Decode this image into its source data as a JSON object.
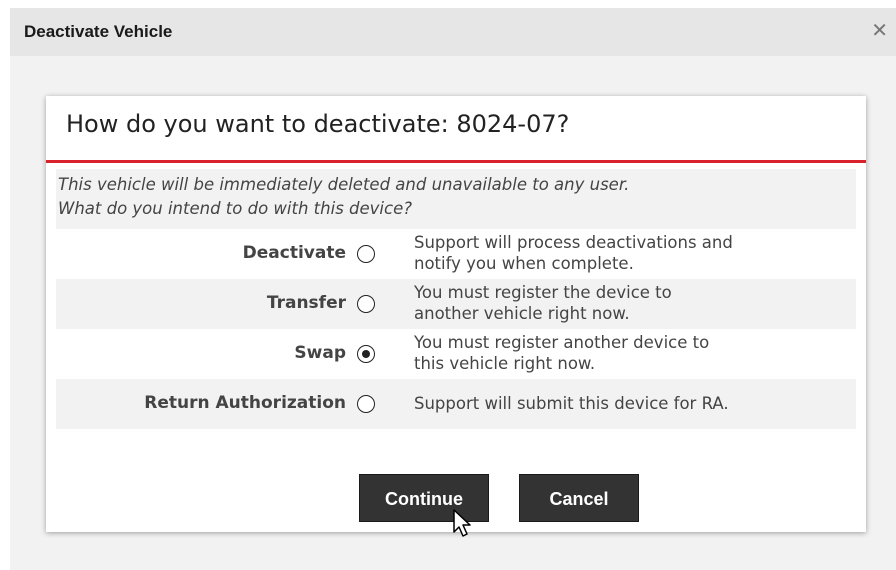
{
  "dialog": {
    "title": "Deactivate Vehicle",
    "close_icon": "close-icon"
  },
  "panel": {
    "heading": "How do you want to deactivate: 8024-07?",
    "intro_line1": "This vehicle will be immediately deleted and unavailable to any user.",
    "intro_line2": "What do you intend to do with this device?"
  },
  "options": [
    {
      "label": "Deactivate",
      "desc1": "Support will process deactivations and",
      "desc2": "notify you when complete.",
      "selected": false
    },
    {
      "label": "Transfer",
      "desc1": "You must register the device to",
      "desc2": "another vehicle right now.",
      "selected": false
    },
    {
      "label": "Swap",
      "desc1": "You must register another device to",
      "desc2": "this vehicle right now.",
      "selected": true
    },
    {
      "label": "Return Authorization",
      "desc1": "Support will submit this device for RA.",
      "desc2": "",
      "selected": false
    }
  ],
  "buttons": {
    "continue_label": "Continue",
    "cancel_label": "Cancel"
  },
  "colors": {
    "accent_red": "#d9222b",
    "button_bg": "#333333"
  }
}
